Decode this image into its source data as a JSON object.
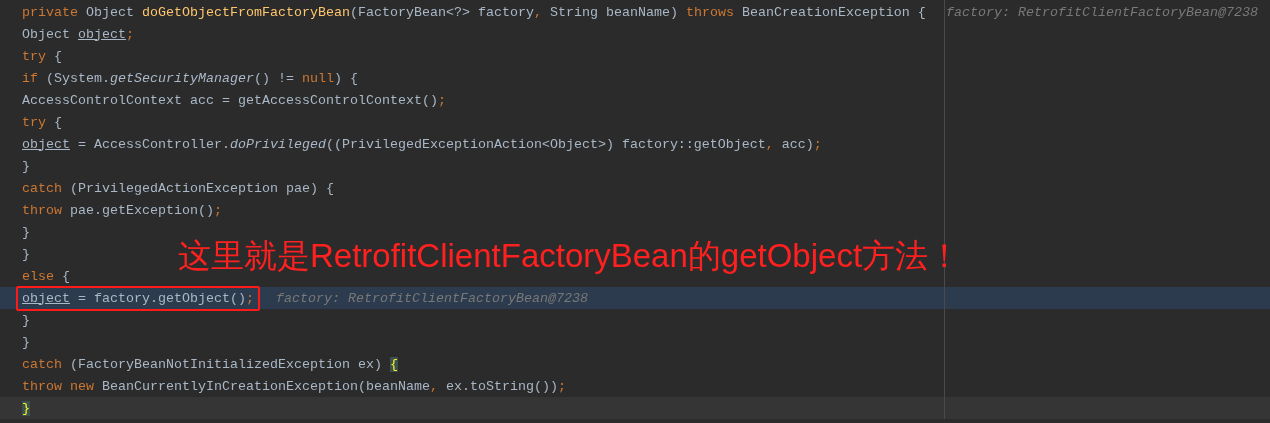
{
  "editor": {
    "lines": [
      {
        "kind": "normal",
        "tokens": [
          {
            "kind": "kw",
            "text": "private "
          },
          {
            "kind": "plain",
            "text": "Object "
          },
          {
            "kind": "decl",
            "text": "doGetObjectFromFactoryBean"
          },
          {
            "kind": "plain",
            "text": "(FactoryBean<?> factory"
          },
          {
            "kind": "kw",
            "text": ", "
          },
          {
            "kind": "plain",
            "text": "String beanName) "
          },
          {
            "kind": "kw",
            "text": "throws "
          },
          {
            "kind": "plain",
            "text": "BeanCreationException {"
          }
        ],
        "hint": "factory: RetrofitClientFactoryBean@7238"
      },
      {
        "kind": "normal",
        "tokens": [
          {
            "kind": "plain",
            "text": "    Object "
          },
          {
            "kind": "field",
            "text": "object"
          },
          {
            "kind": "kw",
            "text": ";"
          }
        ]
      },
      {
        "kind": "normal",
        "tokens": [
          {
            "kind": "kw",
            "text": "    try "
          },
          {
            "kind": "plain",
            "text": "{"
          }
        ]
      },
      {
        "kind": "normal",
        "tokens": [
          {
            "kind": "kw",
            "text": "        if "
          },
          {
            "kind": "plain",
            "text": "(System."
          },
          {
            "kind": "static",
            "text": "getSecurityManager"
          },
          {
            "kind": "plain",
            "text": "() != "
          },
          {
            "kind": "kw",
            "text": "null"
          },
          {
            "kind": "plain",
            "text": ") {"
          }
        ]
      },
      {
        "kind": "normal",
        "tokens": [
          {
            "kind": "plain",
            "text": "            AccessControlContext acc = getAccessControlContext()"
          },
          {
            "kind": "kw",
            "text": ";"
          }
        ]
      },
      {
        "kind": "normal",
        "tokens": [
          {
            "kind": "kw",
            "text": "            try "
          },
          {
            "kind": "plain",
            "text": "{"
          }
        ]
      },
      {
        "kind": "normal",
        "tokens": [
          {
            "kind": "field",
            "text": "                object"
          },
          {
            "kind": "plain",
            "text": " = AccessController."
          },
          {
            "kind": "static",
            "text": "doPrivileged"
          },
          {
            "kind": "plain",
            "text": "((PrivilegedExceptionAction<Object>) factory::getObject"
          },
          {
            "kind": "kw",
            "text": ", "
          },
          {
            "kind": "plain",
            "text": "acc)"
          },
          {
            "kind": "kw",
            "text": ";"
          }
        ]
      },
      {
        "kind": "normal",
        "tokens": [
          {
            "kind": "plain",
            "text": "            }"
          }
        ]
      },
      {
        "kind": "normal",
        "tokens": [
          {
            "kind": "kw",
            "text": "            catch "
          },
          {
            "kind": "plain",
            "text": "(PrivilegedActionException pae) {"
          }
        ]
      },
      {
        "kind": "normal",
        "tokens": [
          {
            "kind": "kw",
            "text": "                throw "
          },
          {
            "kind": "plain",
            "text": "pae.getException()"
          },
          {
            "kind": "kw",
            "text": ";"
          }
        ]
      },
      {
        "kind": "normal",
        "tokens": [
          {
            "kind": "plain",
            "text": "            }"
          }
        ]
      },
      {
        "kind": "normal",
        "tokens": [
          {
            "kind": "plain",
            "text": "        }"
          }
        ]
      },
      {
        "kind": "normal",
        "tokens": [
          {
            "kind": "kw",
            "text": "        else "
          },
          {
            "kind": "plain",
            "text": "{"
          }
        ]
      },
      {
        "kind": "execution",
        "boxed": true,
        "tokens": [
          {
            "kind": "field",
            "text": "            object"
          },
          {
            "kind": "plain",
            "text": " = factory.getObject()"
          },
          {
            "kind": "kw",
            "text": ";"
          }
        ],
        "hint": "factory: RetrofitClientFactoryBean@7238"
      },
      {
        "kind": "normal",
        "tokens": [
          {
            "kind": "plain",
            "text": "        }"
          }
        ]
      },
      {
        "kind": "normal",
        "tokens": [
          {
            "kind": "plain",
            "text": "    }"
          }
        ]
      },
      {
        "kind": "normal",
        "tokens": [
          {
            "kind": "kw",
            "text": "    catch "
          },
          {
            "kind": "plain",
            "text": "(FactoryBeanNotInitializedException ex) "
          },
          {
            "kind": "match",
            "text": "{"
          }
        ]
      },
      {
        "kind": "normal",
        "tokens": [
          {
            "kind": "kw",
            "text": "        throw new "
          },
          {
            "kind": "plain",
            "text": "BeanCurrentlyInCreationException(beanName"
          },
          {
            "kind": "kw",
            "text": ", "
          },
          {
            "kind": "plain",
            "text": "ex.toString())"
          },
          {
            "kind": "kw",
            "text": ";"
          }
        ]
      },
      {
        "kind": "caret",
        "tokens": [
          {
            "kind": "match",
            "text": "    }"
          }
        ]
      }
    ]
  },
  "annotation": {
    "text": "这里就是RetrofitClientFactoryBean的getObject方法！"
  }
}
